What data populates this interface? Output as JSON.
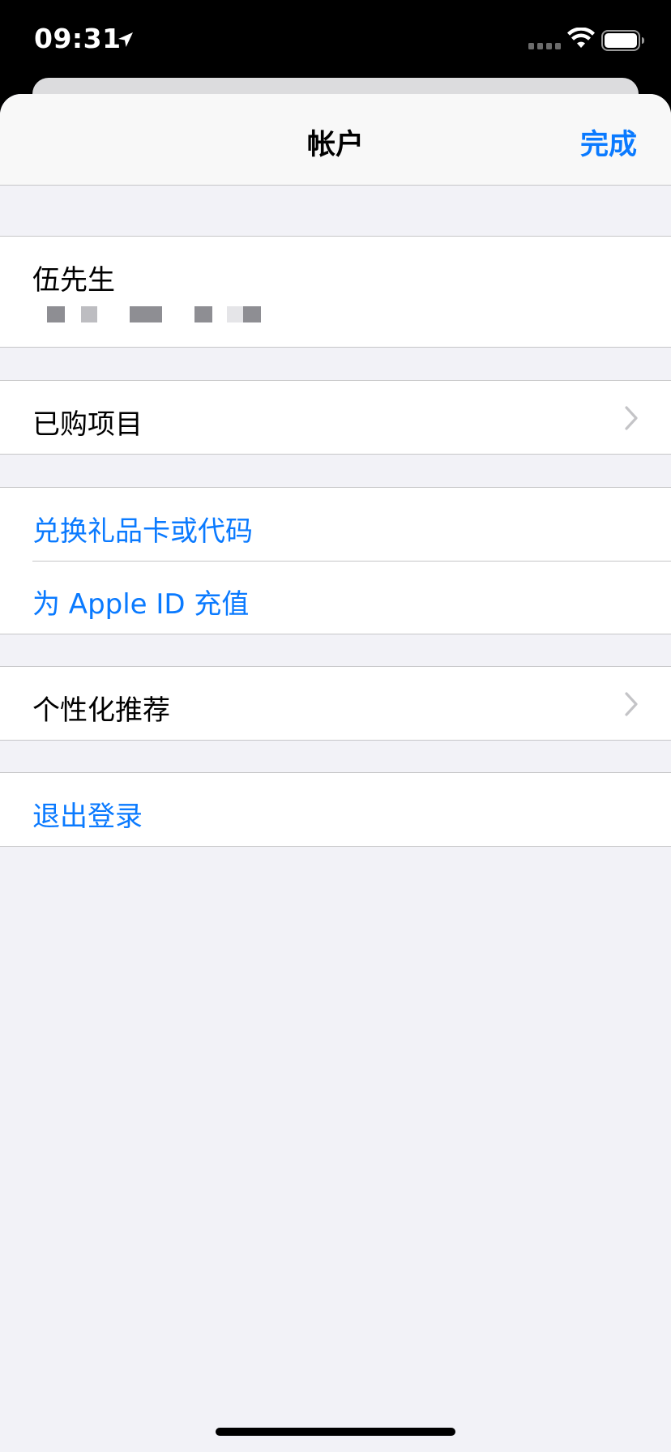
{
  "status_bar": {
    "time": "09:31"
  },
  "nav": {
    "title": "帐户",
    "done_label": "完成"
  },
  "account": {
    "name": "伍先生"
  },
  "menu": {
    "purchased": "已购项目",
    "redeem": "兑换礼品卡或代码",
    "add_funds": "为 Apple ID 充值",
    "personalized": "个性化推荐",
    "sign_out": "退出登录"
  },
  "colors": {
    "accent": "#0a7aff",
    "background": "#f2f2f7",
    "separator": "#c6c6c8"
  },
  "icons": {
    "location": "location-arrow-icon",
    "signal": "cellular-signal-icon",
    "wifi": "wifi-icon",
    "battery": "battery-icon",
    "chevron": "chevron-right-icon"
  }
}
